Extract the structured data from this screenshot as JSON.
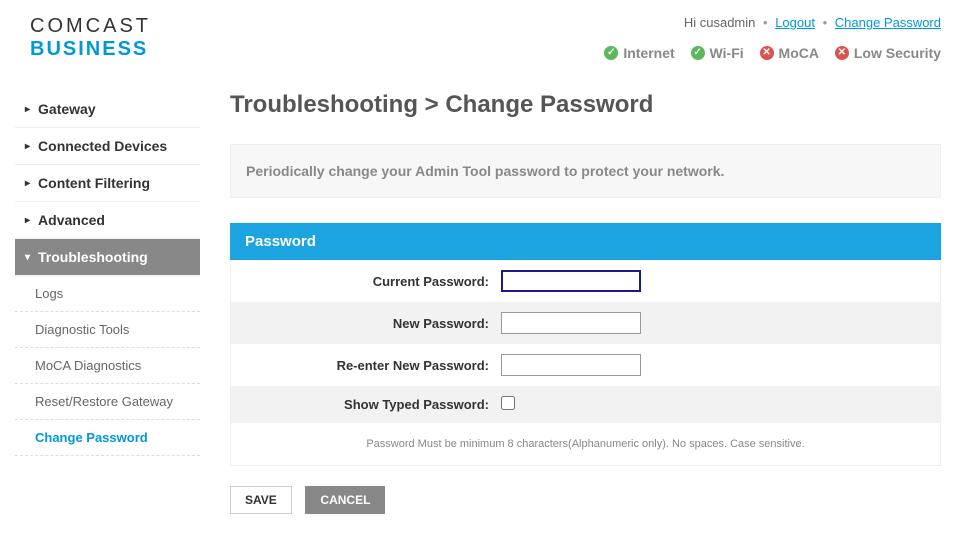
{
  "logo": {
    "line1": "COMCAST",
    "line2": "BUSINESS"
  },
  "header": {
    "greeting": "Hi cusadmin",
    "logout": "Logout",
    "changePassword": "Change Password"
  },
  "status": {
    "internet": "Internet",
    "wifi": "Wi-Fi",
    "moca": "MoCA",
    "security": "Low Security"
  },
  "nav": {
    "gateway": "Gateway",
    "connectedDevices": "Connected Devices",
    "contentFiltering": "Content Filtering",
    "advanced": "Advanced",
    "troubleshooting": "Troubleshooting",
    "sub": {
      "logs": "Logs",
      "diagnosticTools": "Diagnostic Tools",
      "mocaDiagnostics": "MoCA Diagnostics",
      "resetRestore": "Reset/Restore Gateway",
      "changePassword": "Change Password"
    }
  },
  "page": {
    "title": "Troubleshooting > Change Password",
    "info": "Periodically change your Admin Tool password to protect your network.",
    "panelTitle": "Password",
    "labels": {
      "current": "Current Password:",
      "new": "New Password:",
      "reenter": "Re-enter New Password:",
      "show": "Show Typed Password:"
    },
    "hint": "Password Must be minimum 8 characters(Alphanumeric only). No spaces. Case sensitive.",
    "buttons": {
      "save": "SAVE",
      "cancel": "CANCEL"
    }
  }
}
